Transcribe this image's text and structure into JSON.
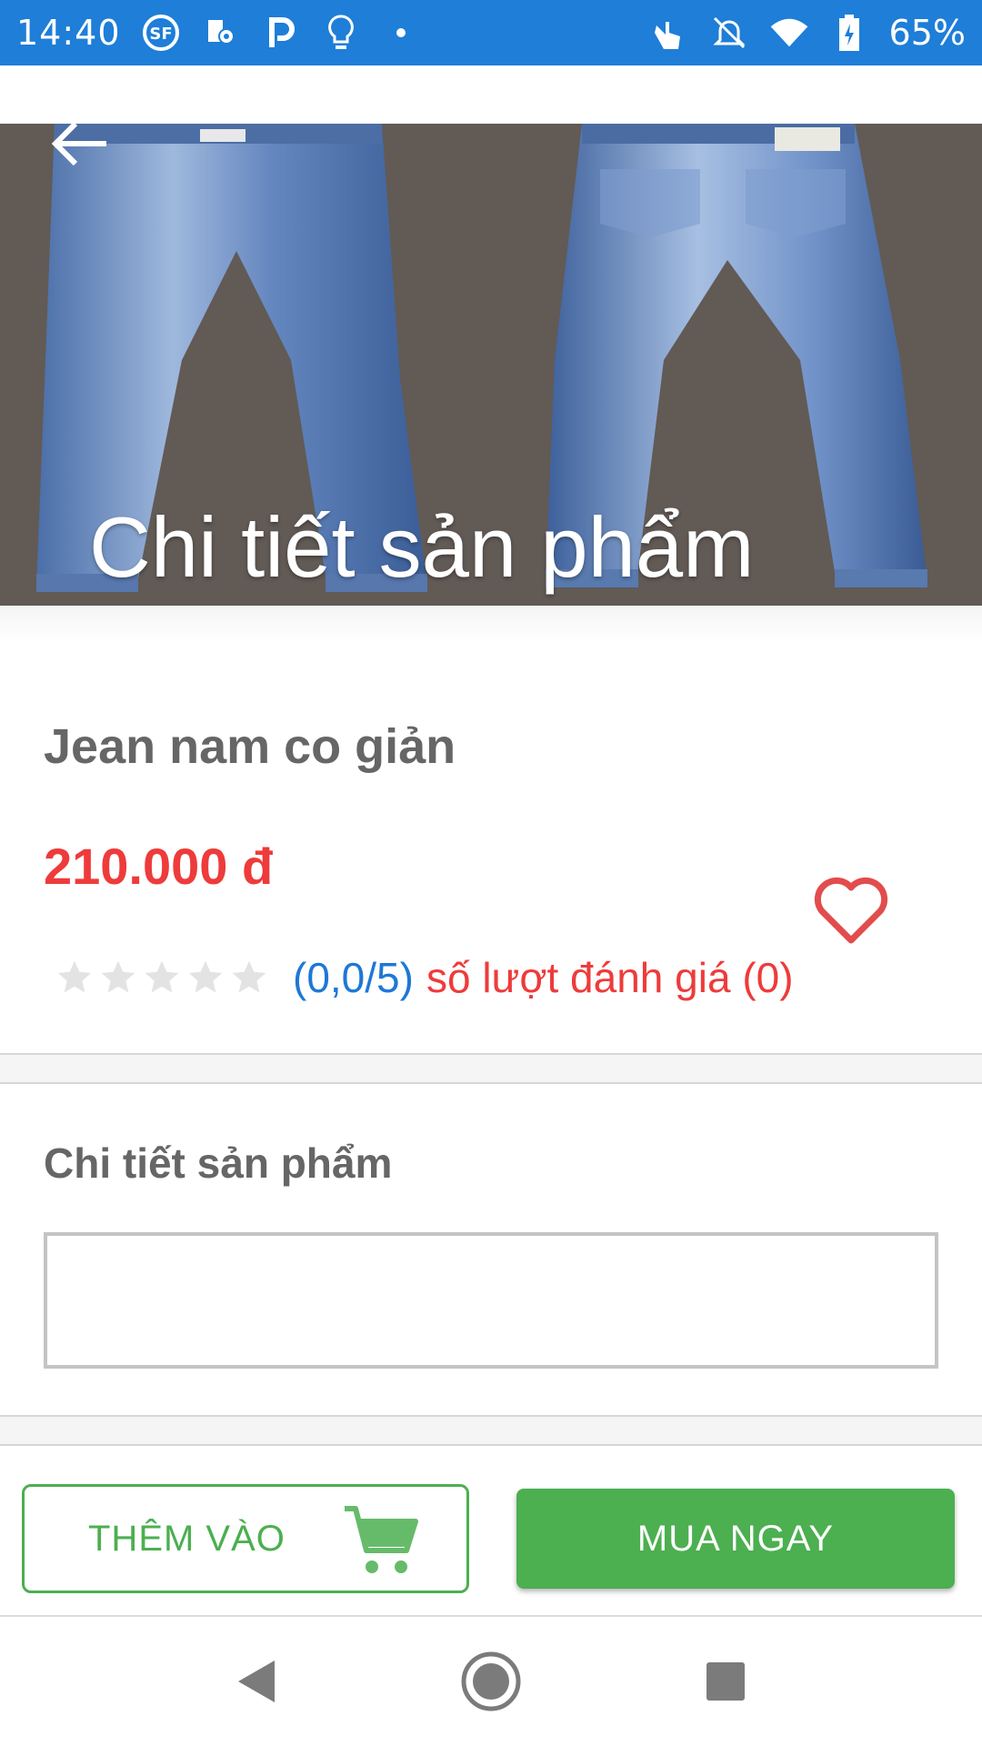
{
  "status_bar": {
    "time": "14:40",
    "battery": "65%",
    "icons": [
      "sf-icon",
      "map-pin-icon",
      "parking-icon",
      "lightbulb-icon",
      "dot-icon",
      "touch-icon",
      "bell-off-icon",
      "wifi-icon",
      "battery-icon"
    ]
  },
  "header": {
    "title": "Chi tiết sản phẩm",
    "back_icon": "arrow-left-icon"
  },
  "product": {
    "name": "Jean nam co giản",
    "price": "210.000 đ",
    "rating_score": "(0,0/5)",
    "rating_count": "số lượt đánh giá (0)",
    "stars_filled": 0,
    "stars_total": 5,
    "favorite_icon": "heart-outline-icon"
  },
  "details": {
    "title": "Chi tiết sản phẩm",
    "content": ""
  },
  "actions": {
    "add_label": "THÊM VÀO",
    "buy_label": "MUA NGAY"
  },
  "colors": {
    "status_bar": "#1e7ed8",
    "accent_green": "#4caf50",
    "price_red": "#ee3b3b",
    "rating_blue": "#1e78d6"
  }
}
